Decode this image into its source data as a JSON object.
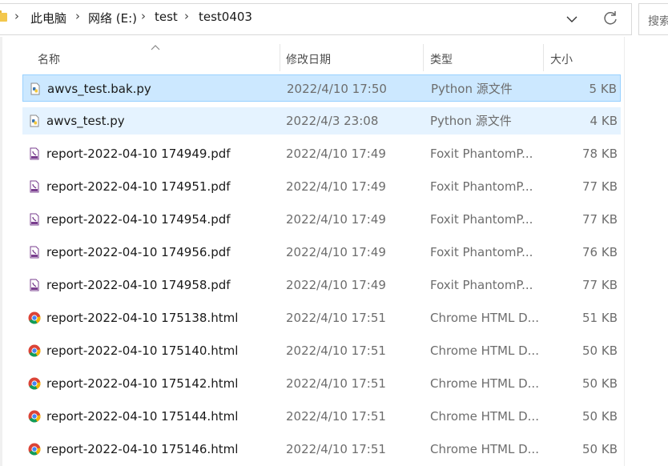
{
  "address_bar": {
    "crumbs": [
      "此电脑",
      "网络 (E:)",
      "test",
      "test0403"
    ],
    "search_placeholder": "搜索"
  },
  "columns": {
    "name": "名称",
    "date": "修改日期",
    "type": "类型",
    "size": "大小"
  },
  "files": [
    {
      "name": "awvs_test.bak.py",
      "date": "2022/4/10 17:50",
      "type": "Python 源文件",
      "size": "5 KB",
      "icon": "python-file-icon",
      "state": "selected"
    },
    {
      "name": "awvs_test.py",
      "date": "2022/4/3 23:08",
      "type": "Python 源文件",
      "size": "4 KB",
      "icon": "python-file-icon",
      "state": "hover"
    },
    {
      "name": "report-2022-04-10 174949.pdf",
      "date": "2022/4/10 17:49",
      "type": "Foxit PhantomP...",
      "size": "78 KB",
      "icon": "pdf-file-icon"
    },
    {
      "name": "report-2022-04-10 174951.pdf",
      "date": "2022/4/10 17:49",
      "type": "Foxit PhantomP...",
      "size": "77 KB",
      "icon": "pdf-file-icon"
    },
    {
      "name": "report-2022-04-10 174954.pdf",
      "date": "2022/4/10 17:49",
      "type": "Foxit PhantomP...",
      "size": "77 KB",
      "icon": "pdf-file-icon"
    },
    {
      "name": "report-2022-04-10 174956.pdf",
      "date": "2022/4/10 17:49",
      "type": "Foxit PhantomP...",
      "size": "76 KB",
      "icon": "pdf-file-icon"
    },
    {
      "name": "report-2022-04-10 174958.pdf",
      "date": "2022/4/10 17:49",
      "type": "Foxit PhantomP...",
      "size": "77 KB",
      "icon": "pdf-file-icon"
    },
    {
      "name": "report-2022-04-10 175138.html",
      "date": "2022/4/10 17:51",
      "type": "Chrome HTML D...",
      "size": "51 KB",
      "icon": "chrome-html-icon"
    },
    {
      "name": "report-2022-04-10 175140.html",
      "date": "2022/4/10 17:51",
      "type": "Chrome HTML D...",
      "size": "50 KB",
      "icon": "chrome-html-icon"
    },
    {
      "name": "report-2022-04-10 175142.html",
      "date": "2022/4/10 17:51",
      "type": "Chrome HTML D...",
      "size": "50 KB",
      "icon": "chrome-html-icon"
    },
    {
      "name": "report-2022-04-10 175144.html",
      "date": "2022/4/10 17:51",
      "type": "Chrome HTML D...",
      "size": "50 KB",
      "icon": "chrome-html-icon"
    },
    {
      "name": "report-2022-04-10 175146.html",
      "date": "2022/4/10 17:51",
      "type": "Chrome HTML D...",
      "size": "50 KB",
      "icon": "chrome-html-icon"
    }
  ]
}
